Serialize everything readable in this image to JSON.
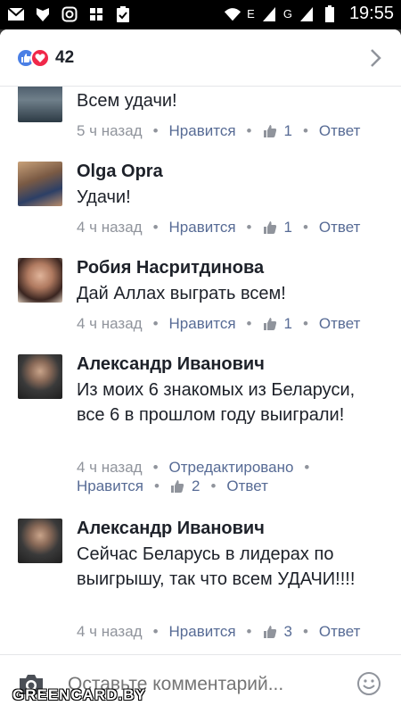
{
  "status_bar": {
    "time": "19:55",
    "network_letter_1": "E",
    "network_letter_2": "G",
    "icons": [
      "mail-icon",
      "shield-icon",
      "instagram-icon",
      "app-icon",
      "clipboard-icon",
      "wifi-icon",
      "signal-icon",
      "signal-icon",
      "battery-icon"
    ]
  },
  "header": {
    "reaction_count": "42",
    "icons": [
      "like-reaction-icon",
      "love-reaction-icon",
      "chevron-right-icon"
    ]
  },
  "comments": [
    {
      "name": "",
      "text": "Всем удачи!",
      "time": "5 ч назад",
      "like_label": "Нравится",
      "likes": "1",
      "reply_label": "Ответ"
    },
    {
      "name": "Olga Opra",
      "text": "Удачи!",
      "time": "4 ч назад",
      "like_label": "Нравится",
      "likes": "1",
      "reply_label": "Ответ"
    },
    {
      "name": "Робия Насритдинова",
      "text": "Дай Аллах выграть всем!",
      "time": "4 ч назад",
      "like_label": "Нравится",
      "likes": "1",
      "reply_label": "Ответ"
    },
    {
      "name": "Александр Иванович",
      "text": "Из моих 6 знакомых из Беларуси, все 6 в прошлом году выиграли!",
      "time": "4 ч назад",
      "edited_label": "Отредактировано",
      "like_label": "Нравится",
      "likes": "2",
      "reply_label": "Ответ"
    },
    {
      "name": "Александр Иванович",
      "text": "Сейчас Беларусь в лидерах по выигрышу, так что всем УДАЧИ!!!!",
      "time": "4 ч назад",
      "like_label": "Нравится",
      "likes": "3",
      "reply_label": "Ответ"
    }
  ],
  "composer": {
    "placeholder": "Оставьте комментарий...",
    "icons": [
      "camera-icon",
      "smiley-icon"
    ]
  },
  "watermark": "GREENCARD.BY",
  "colors": {
    "link": "#576b95",
    "meta": "#90949c",
    "text": "#1d2129",
    "like_blue": "#4a7fe5",
    "love_red": "#f0284a"
  }
}
